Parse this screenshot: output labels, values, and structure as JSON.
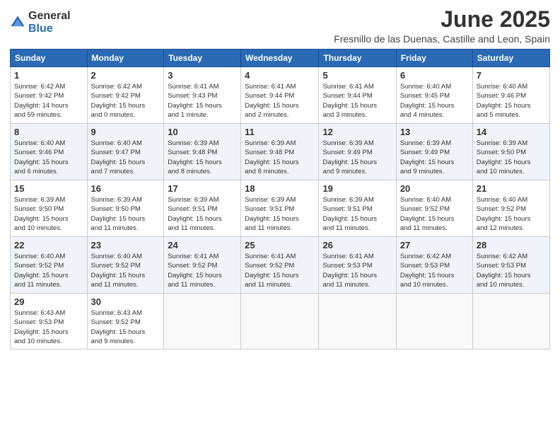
{
  "logo": {
    "general": "General",
    "blue": "Blue"
  },
  "title": "June 2025",
  "subtitle": "Fresnillo de las Duenas, Castille and Leon, Spain",
  "headers": [
    "Sunday",
    "Monday",
    "Tuesday",
    "Wednesday",
    "Thursday",
    "Friday",
    "Saturday"
  ],
  "weeks": [
    [
      {
        "day": "1",
        "info": "Sunrise: 6:42 AM\nSunset: 9:42 PM\nDaylight: 14 hours\nand 59 minutes."
      },
      {
        "day": "2",
        "info": "Sunrise: 6:42 AM\nSunset: 9:42 PM\nDaylight: 15 hours\nand 0 minutes."
      },
      {
        "day": "3",
        "info": "Sunrise: 6:41 AM\nSunset: 9:43 PM\nDaylight: 15 hours\nand 1 minute."
      },
      {
        "day": "4",
        "info": "Sunrise: 6:41 AM\nSunset: 9:44 PM\nDaylight: 15 hours\nand 2 minutes."
      },
      {
        "day": "5",
        "info": "Sunrise: 6:41 AM\nSunset: 9:44 PM\nDaylight: 15 hours\nand 3 minutes."
      },
      {
        "day": "6",
        "info": "Sunrise: 6:40 AM\nSunset: 9:45 PM\nDaylight: 15 hours\nand 4 minutes."
      },
      {
        "day": "7",
        "info": "Sunrise: 6:40 AM\nSunset: 9:46 PM\nDaylight: 15 hours\nand 5 minutes."
      }
    ],
    [
      {
        "day": "8",
        "info": "Sunrise: 6:40 AM\nSunset: 9:46 PM\nDaylight: 15 hours\nand 6 minutes."
      },
      {
        "day": "9",
        "info": "Sunrise: 6:40 AM\nSunset: 9:47 PM\nDaylight: 15 hours\nand 7 minutes."
      },
      {
        "day": "10",
        "info": "Sunrise: 6:39 AM\nSunset: 9:48 PM\nDaylight: 15 hours\nand 8 minutes."
      },
      {
        "day": "11",
        "info": "Sunrise: 6:39 AM\nSunset: 9:48 PM\nDaylight: 15 hours\nand 8 minutes."
      },
      {
        "day": "12",
        "info": "Sunrise: 6:39 AM\nSunset: 9:49 PM\nDaylight: 15 hours\nand 9 minutes."
      },
      {
        "day": "13",
        "info": "Sunrise: 6:39 AM\nSunset: 9:49 PM\nDaylight: 15 hours\nand 9 minutes."
      },
      {
        "day": "14",
        "info": "Sunrise: 6:39 AM\nSunset: 9:50 PM\nDaylight: 15 hours\nand 10 minutes."
      }
    ],
    [
      {
        "day": "15",
        "info": "Sunrise: 6:39 AM\nSunset: 9:50 PM\nDaylight: 15 hours\nand 10 minutes."
      },
      {
        "day": "16",
        "info": "Sunrise: 6:39 AM\nSunset: 9:50 PM\nDaylight: 15 hours\nand 11 minutes."
      },
      {
        "day": "17",
        "info": "Sunrise: 6:39 AM\nSunset: 9:51 PM\nDaylight: 15 hours\nand 11 minutes."
      },
      {
        "day": "18",
        "info": "Sunrise: 6:39 AM\nSunset: 9:51 PM\nDaylight: 15 hours\nand 11 minutes."
      },
      {
        "day": "19",
        "info": "Sunrise: 6:39 AM\nSunset: 9:51 PM\nDaylight: 15 hours\nand 11 minutes."
      },
      {
        "day": "20",
        "info": "Sunrise: 6:40 AM\nSunset: 9:52 PM\nDaylight: 15 hours\nand 11 minutes."
      },
      {
        "day": "21",
        "info": "Sunrise: 6:40 AM\nSunset: 9:52 PM\nDaylight: 15 hours\nand 12 minutes."
      }
    ],
    [
      {
        "day": "22",
        "info": "Sunrise: 6:40 AM\nSunset: 9:52 PM\nDaylight: 15 hours\nand 11 minutes."
      },
      {
        "day": "23",
        "info": "Sunrise: 6:40 AM\nSunset: 9:52 PM\nDaylight: 15 hours\nand 11 minutes."
      },
      {
        "day": "24",
        "info": "Sunrise: 6:41 AM\nSunset: 9:52 PM\nDaylight: 15 hours\nand 11 minutes."
      },
      {
        "day": "25",
        "info": "Sunrise: 6:41 AM\nSunset: 9:52 PM\nDaylight: 15 hours\nand 11 minutes."
      },
      {
        "day": "26",
        "info": "Sunrise: 6:41 AM\nSunset: 9:53 PM\nDaylight: 15 hours\nand 11 minutes."
      },
      {
        "day": "27",
        "info": "Sunrise: 6:42 AM\nSunset: 9:53 PM\nDaylight: 15 hours\nand 10 minutes."
      },
      {
        "day": "28",
        "info": "Sunrise: 6:42 AM\nSunset: 9:53 PM\nDaylight: 15 hours\nand 10 minutes."
      }
    ],
    [
      {
        "day": "29",
        "info": "Sunrise: 6:43 AM\nSunset: 9:53 PM\nDaylight: 15 hours\nand 10 minutes."
      },
      {
        "day": "30",
        "info": "Sunrise: 6:43 AM\nSunset: 9:52 PM\nDaylight: 15 hours\nand 9 minutes."
      },
      {
        "day": "",
        "info": ""
      },
      {
        "day": "",
        "info": ""
      },
      {
        "day": "",
        "info": ""
      },
      {
        "day": "",
        "info": ""
      },
      {
        "day": "",
        "info": ""
      }
    ]
  ]
}
